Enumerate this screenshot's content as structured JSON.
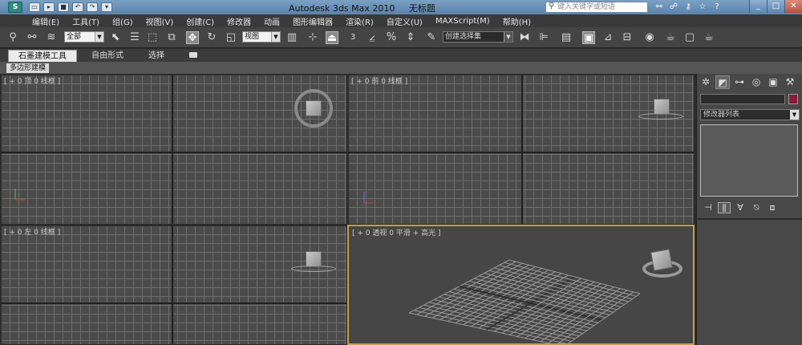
{
  "title_bar": {
    "app_name": "Autodesk 3ds Max  2010",
    "doc_name": "无标题",
    "search_placeholder": "键入关键字或短语",
    "quick_access": [
      "new",
      "open",
      "save",
      "undo",
      "redo",
      "more"
    ],
    "title_icons": [
      "binoculars-icon",
      "communication-icon",
      "key-icon",
      "star-icon",
      "help-icon"
    ],
    "window_buttons": [
      "_",
      "□",
      "✕"
    ]
  },
  "menu": {
    "items": [
      "编辑(E)",
      "工具(T)",
      "组(G)",
      "视图(V)",
      "创建(C)",
      "修改器",
      "动画",
      "图形编辑器",
      "渲染(R)",
      "自定义(U)",
      "MAXScript(M)",
      "帮助(H)"
    ]
  },
  "toolbar": {
    "selection_filter": "全部",
    "coord_system": "视图",
    "named_selection": "创建选择集",
    "spinner_snap_value": "3"
  },
  "ribbon": {
    "tabs": [
      "石墨建模工具",
      "自由形式",
      "选择"
    ],
    "active_tab": "石墨建模工具",
    "sub_label": "多边形建模"
  },
  "viewports": {
    "top": "[ + 0 顶 0 线框 ]",
    "front": "[ + 0 前 0 线框 ]",
    "left": "[ + 0 左 0 线框 ]",
    "perspective": "[ + 0 透视 0 平滑 + 高光 ]"
  },
  "command_panel": {
    "modifier_list": "修改器列表",
    "object_color": "#8a1b3a"
  },
  "colors": {
    "viewport_bg": "#4b4b4b",
    "active_viewport_border": "#c5a23a",
    "titlebar": "#6b91b8"
  }
}
